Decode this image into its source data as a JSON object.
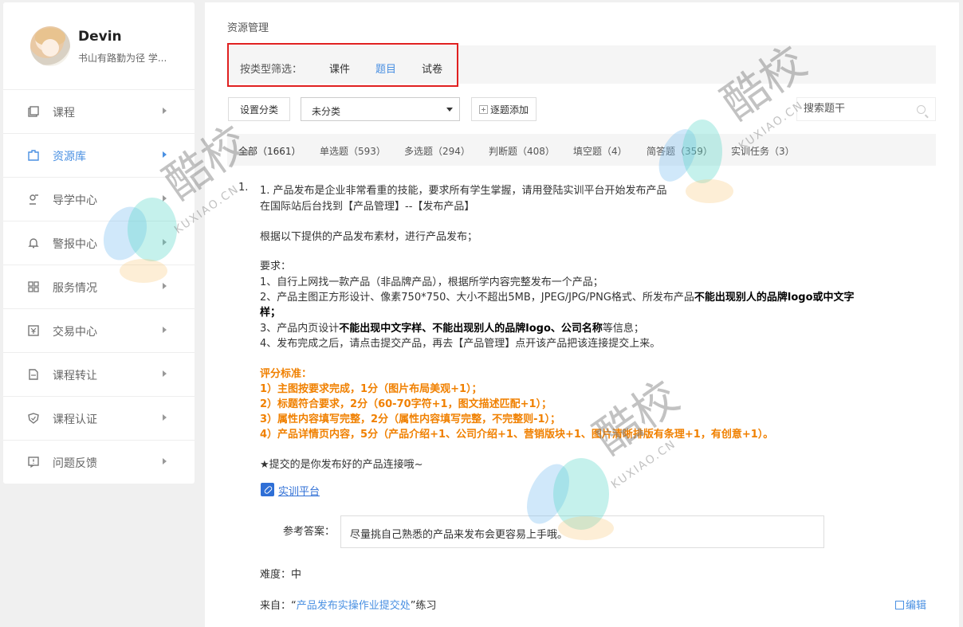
{
  "profile": {
    "name": "Devin",
    "motto": "书山有路勤为径 学..."
  },
  "sidebar": {
    "items": [
      {
        "label": "课程",
        "icon": "course-icon"
      },
      {
        "label": "资源库",
        "icon": "resource-icon"
      },
      {
        "label": "导学中心",
        "icon": "guide-icon"
      },
      {
        "label": "警报中心",
        "icon": "bell-icon"
      },
      {
        "label": "服务情况",
        "icon": "grid-icon"
      },
      {
        "label": "交易中心",
        "icon": "trade-icon"
      },
      {
        "label": "课程转让",
        "icon": "transfer-icon"
      },
      {
        "label": "课程认证",
        "icon": "shield-icon"
      },
      {
        "label": "问题反馈",
        "icon": "feedback-icon"
      }
    ],
    "active_index": 1
  },
  "main": {
    "title": "资源管理",
    "filter": {
      "label": "按类型筛选：",
      "options": [
        "课件",
        "题目",
        "试卷"
      ],
      "active": "题目"
    },
    "toolbar": {
      "set_category": "设置分类",
      "category_value": "未分类",
      "add_one_by_one": "逐题添加",
      "search_placeholder": "搜索题干"
    },
    "type_tabs": [
      "全部（1661）",
      "单选题（593）",
      "多选题（294）",
      "判断题（408）",
      "填空题（4）",
      "简答题（359）",
      "实训任务（3）"
    ],
    "question": {
      "number": "1.",
      "lines": {
        "l1": "1. 产品发布是企业非常看重的技能，要求所有学生掌握，请用登陆实训平台开始发布产品",
        "l2": "在国际站后台找到【产品管理】--【发布产品】",
        "l3": "根据以下提供的产品发布素材，进行产品发布；",
        "l4": "要求：",
        "l5": "1、自行上网找一款产品（非品牌产品），根据所学内容完整发布一个产品；",
        "l6a": "2、产品主图正方形设计、像素750*750、大小不超出5MB，JPEG/JPG/PNG格式、所发布产品",
        "l6b": "不能出现别人的品牌logo或中文字",
        "l7": "样；",
        "l8a": "3、产品内页设计",
        "l8b": "不能出现中文字样、不能出现别人的品牌logo、公司名称",
        "l8c": "等信息；",
        "l9": "4、发布完成之后，请点击提交产品，再去【产品管理】点开该产品把该连接提交上来。"
      },
      "scoring": [
        "评分标准：",
        "1）主图按要求完成，1分（图片布局美观+1）；",
        "2）标题符合要求，2分（60-70字符+1，图文描述匹配+1）；",
        "3）属性内容填写完整，2分（属性内容填写完整，不完整则-1）；",
        "4）产品详情页内容，5分（产品介绍+1、公司介绍+1、营销版块+1、图片清晰排版有条理+1，有创意+1）。"
      ],
      "submit_note": "★提交的是你发布好的产品连接哦~",
      "link_text": "实训平台",
      "answer_label": "参考答案：",
      "answer_text": "尽量挑自己熟悉的产品来发布会更容易上手哦。",
      "difficulty": "难度：中",
      "source_prefix": "来自：“",
      "source_link": "产品发布实操作业提交处",
      "source_suffix": "”练习",
      "edit_label": "编辑"
    }
  },
  "watermark": {
    "text": "酷校",
    "sub": "KUXIAO.CN"
  },
  "colors": {
    "accent": "#4a90e2",
    "orange": "#f08000",
    "highlight_border": "#e02020"
  }
}
